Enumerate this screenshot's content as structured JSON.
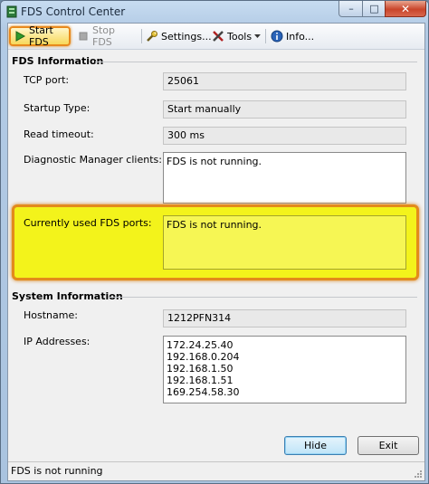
{
  "window": {
    "title": "FDS Control Center",
    "min_glyph": "–",
    "max_glyph": "□",
    "close_glyph": "✕"
  },
  "toolbar": {
    "start_label": "Start FDS",
    "stop_label": "Stop FDS",
    "settings_label": "Settings...",
    "tools_label": "Tools",
    "info_label": "Info..."
  },
  "fds_info": {
    "section_title": "FDS Information",
    "tcp_port_label": "TCP port:",
    "tcp_port_value": "25061",
    "startup_type_label": "Startup Type:",
    "startup_type_value": "Start manually",
    "read_timeout_label": "Read timeout:",
    "read_timeout_value": "300 ms",
    "diag_clients_label": "Diagnostic Manager clients:",
    "diag_clients_value": "FDS is not running.",
    "ports_label": "Currently used FDS ports:",
    "ports_value": "FDS is not running."
  },
  "system_info": {
    "section_title": "System Information",
    "hostname_label": "Hostname:",
    "hostname_value": "1212PFN314",
    "ip_label": "IP Addresses:",
    "ip_addresses": [
      "172.24.25.40",
      "192.168.0.204",
      "192.168.1.50",
      "192.168.1.51",
      "169.254.58.30"
    ]
  },
  "buttons": {
    "hide_label": "Hide",
    "exit_label": "Exit"
  },
  "status": {
    "text": "FDS is not running"
  },
  "colors": {
    "highlight": "#f3f31b",
    "highlight_border": "#e38a1b",
    "close_button": "#c9452b"
  },
  "icons": {
    "start": "play-icon",
    "stop": "stop-icon",
    "settings": "wrench-icon",
    "tools": "tools-icon",
    "info": "info-icon",
    "tools_dropdown": "chevron-down-icon"
  }
}
